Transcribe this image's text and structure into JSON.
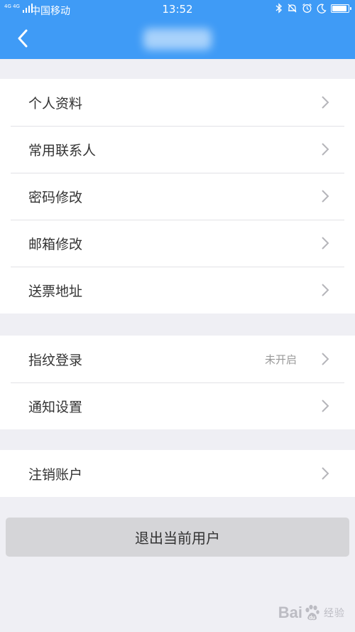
{
  "colors": {
    "header": "#3f9bf6",
    "background": "#efeff4",
    "logout_button": "#d5d5d8"
  },
  "status_bar": {
    "network": "4G 4G",
    "carrier": "中国移动",
    "time": "13:52",
    "icons": [
      "bluetooth-icon",
      "bell-mute-icon",
      "alarm-icon",
      "moon-icon",
      "battery-icon"
    ],
    "battery_level": 0.85
  },
  "header": {
    "back_icon": "chevron-left-icon",
    "title_blurred": true
  },
  "groups": [
    {
      "items": [
        {
          "label": "个人资料"
        },
        {
          "label": "常用联系人"
        },
        {
          "label": "密码修改"
        },
        {
          "label": "邮箱修改"
        },
        {
          "label": "送票地址"
        }
      ]
    },
    {
      "items": [
        {
          "label": "指纹登录",
          "value": "未开启"
        },
        {
          "label": "通知设置"
        }
      ]
    },
    {
      "items": [
        {
          "label": "注销账户"
        }
      ]
    }
  ],
  "logout_button": "退出当前用户",
  "watermark": {
    "text_left": "Bai",
    "text_right": "经验",
    "icon": "baidu-paw-icon"
  }
}
